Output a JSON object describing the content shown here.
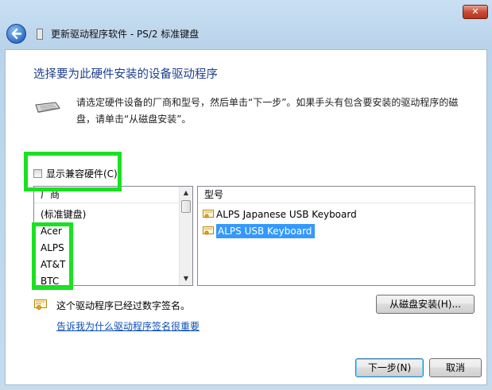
{
  "window": {
    "close_glyph": "✕",
    "title": "更新驱动程序软件 - PS/2 标准键盘"
  },
  "page": {
    "heading": "选择要为此硬件安装的设备驱动程序",
    "instructions": "请选定硬件设备的厂商和型号，然后单击“下一步”。如果手头有包含要安装的驱动程序的磁盘，请单击“从磁盘安装”。"
  },
  "compat": {
    "label": "显示兼容硬件(C)",
    "checked": false
  },
  "manufacturers": {
    "header": "厂商",
    "items": [
      "(标准键盘)",
      "Acer",
      "ALPS",
      "AT&T",
      "BTC"
    ]
  },
  "models": {
    "header": "型号",
    "items": [
      {
        "label": "ALPS Japanese USB Keyboard",
        "selected": false
      },
      {
        "label": "ALPS USB Keyboard",
        "selected": true
      }
    ]
  },
  "signature": {
    "text": "这个驱动程序已经过数字签名。",
    "link": "告诉我为什么驱动程序签名很重要"
  },
  "buttons": {
    "have_disk": "从磁盘安装(H)...",
    "next": "下一步(N)",
    "cancel": "取消"
  },
  "colors": {
    "highlight": "#19e221",
    "selection": "#3399ff",
    "heading": "#1e3f8f",
    "link": "#0d4fb8"
  }
}
